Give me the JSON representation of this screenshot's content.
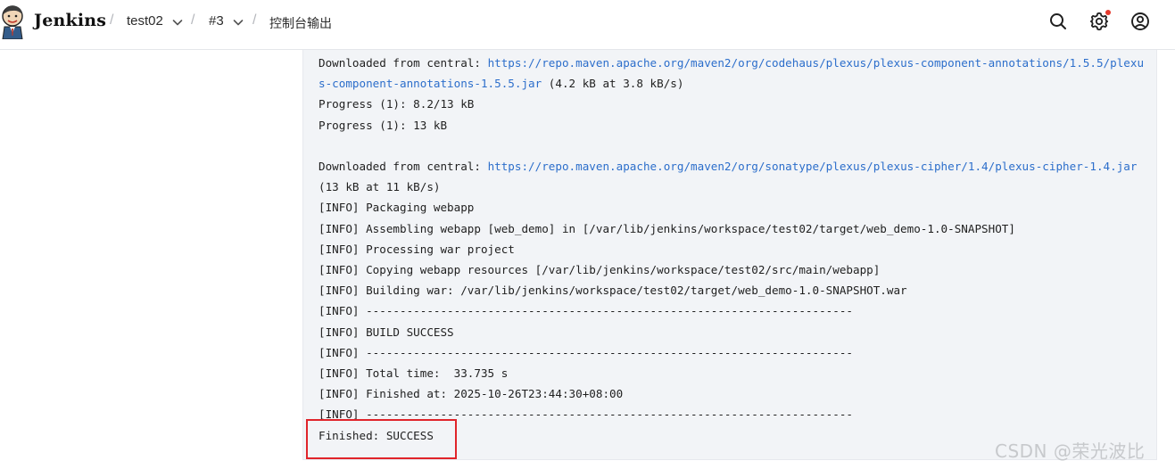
{
  "header": {
    "brand": "Jenkins",
    "breadcrumbs": [
      {
        "label": "test02",
        "has_dropdown": true
      },
      {
        "label": "#3",
        "has_dropdown": true
      },
      {
        "label": "控制台输出",
        "has_dropdown": false
      }
    ],
    "icons": [
      "search-icon",
      "gear-icon",
      "user-icon"
    ],
    "colors": {
      "notification_dot": "#e5392c",
      "link": "#2c6ecb",
      "highlight": "#e0242a"
    }
  },
  "console": {
    "lines": [
      {
        "pre": "Downloaded from central: ",
        "link": "https://repo.maven.apache.org/maven2/org/codehaus/plexus/plexus-component-annotations/1.5.5/plexus-component-annotations-1.5.5.jar",
        "post": " (4.2 kB at 3.8 kB/s)"
      },
      {
        "pre": "Progress (1): 8.2/13 kB",
        "link": "",
        "post": ""
      },
      {
        "pre": "Progress (1): 13 kB",
        "link": "",
        "post": ""
      },
      {
        "pre": "",
        "link": "",
        "post": ""
      },
      {
        "pre": "Downloaded from central: ",
        "link": "https://repo.maven.apache.org/maven2/org/sonatype/plexus/plexus-cipher/1.4/plexus-cipher-1.4.jar",
        "post": " (13 kB at 11 kB/s)"
      },
      {
        "pre": "[INFO] Packaging webapp",
        "link": "",
        "post": ""
      },
      {
        "pre": "[INFO] Assembling webapp [web_demo] in [/var/lib/jenkins/workspace/test02/target/web_demo-1.0-SNAPSHOT]",
        "link": "",
        "post": ""
      },
      {
        "pre": "[INFO] Processing war project",
        "link": "",
        "post": ""
      },
      {
        "pre": "[INFO] Copying webapp resources [/var/lib/jenkins/workspace/test02/src/main/webapp]",
        "link": "",
        "post": ""
      },
      {
        "pre": "[INFO] Building war: /var/lib/jenkins/workspace/test02/target/web_demo-1.0-SNAPSHOT.war",
        "link": "",
        "post": ""
      },
      {
        "pre": "[INFO] ------------------------------------------------------------------------",
        "link": "",
        "post": ""
      },
      {
        "pre": "[INFO] BUILD SUCCESS",
        "link": "",
        "post": ""
      },
      {
        "pre": "[INFO] ------------------------------------------------------------------------",
        "link": "",
        "post": ""
      },
      {
        "pre": "[INFO] Total time:  33.735 s",
        "link": "",
        "post": ""
      },
      {
        "pre": "[INFO] Finished at: 2025-10-26T23:44:30+08:00",
        "link": "",
        "post": ""
      },
      {
        "pre": "[INFO] ------------------------------------------------------------------------",
        "link": "",
        "post": ""
      },
      {
        "pre": "Finished: SUCCESS",
        "link": "",
        "post": ""
      }
    ]
  },
  "watermark": "CSDN @荣光波比"
}
